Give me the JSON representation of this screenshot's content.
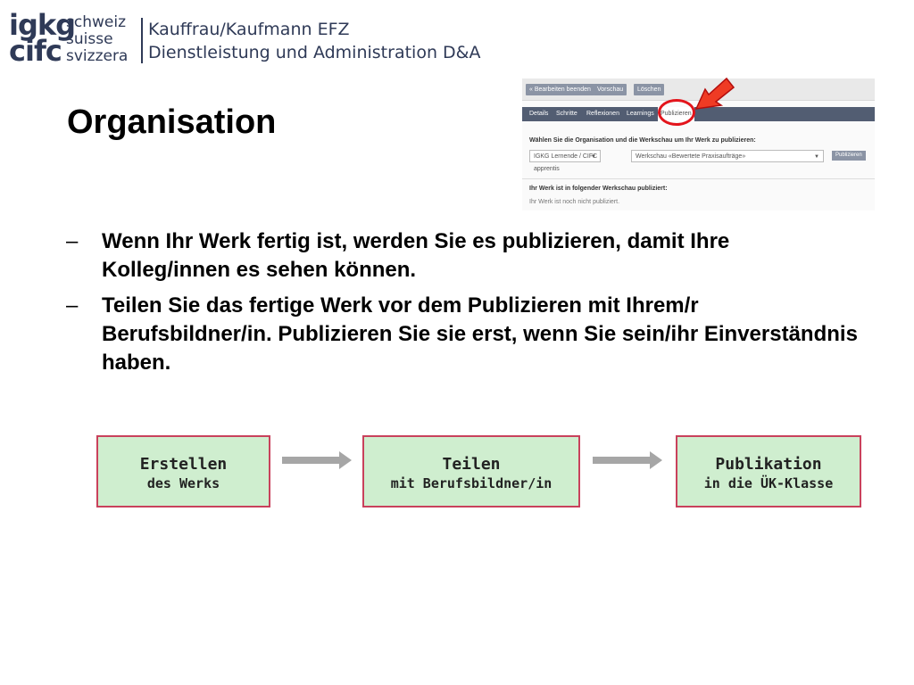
{
  "header": {
    "logo_mark": [
      "igkg",
      "cifc"
    ],
    "logo_languages": [
      "schweiz",
      "suisse",
      "svizzera"
    ],
    "title_line1": "Kauffrau/Kaufmann EFZ",
    "title_line2": "Dienstleistung und Administration D&A"
  },
  "slide": {
    "title": "Organisation",
    "bullets": [
      "Wenn Ihr Werk fertig ist, werden Sie es publizieren, damit Ihre Kolleg/innen es sehen können.",
      "Teilen Sie das fertige Werk vor dem Publizieren mit Ihrem/r Berufsbildner/in. Publizieren Sie sie erst, wenn Sie sein/ihr Einverständnis haben."
    ],
    "bullet_marker": "–"
  },
  "screenshot": {
    "toolbar_buttons": [
      "« Bearbeiten beenden",
      "Vorschau",
      "Löschen"
    ],
    "tabs": [
      "Details",
      "Schritte",
      "Reflexionen",
      "Learnings",
      "Publizieren"
    ],
    "active_tab": "Publizieren",
    "instruction": "Wählen Sie die Organisation und die Werkschau um Ihr Werk zu publizieren:",
    "organisation_select": "IGKG Lernende / CIFC apprentis",
    "werkschau_select": "Werkschau «Bewertete Praxisaufträge»",
    "publish_button": "Publizieren",
    "published_label": "Ihr Werk ist in folgender Werkschau publiziert:",
    "published_note": "Ihr Werk ist noch nicht publiziert.",
    "highlight_color": "#e3141b"
  },
  "flow": {
    "steps": [
      {
        "line1": "Erstellen",
        "line2": "des Werks"
      },
      {
        "line1": "Teilen",
        "line2": "mit Berufsbildner/in"
      },
      {
        "line1": "Publikation",
        "line2": "in die ÜK-Klasse"
      }
    ],
    "box_fill": "#cfeecf",
    "box_border": "#c9415c",
    "arrow_color": "#a6a6a6"
  }
}
